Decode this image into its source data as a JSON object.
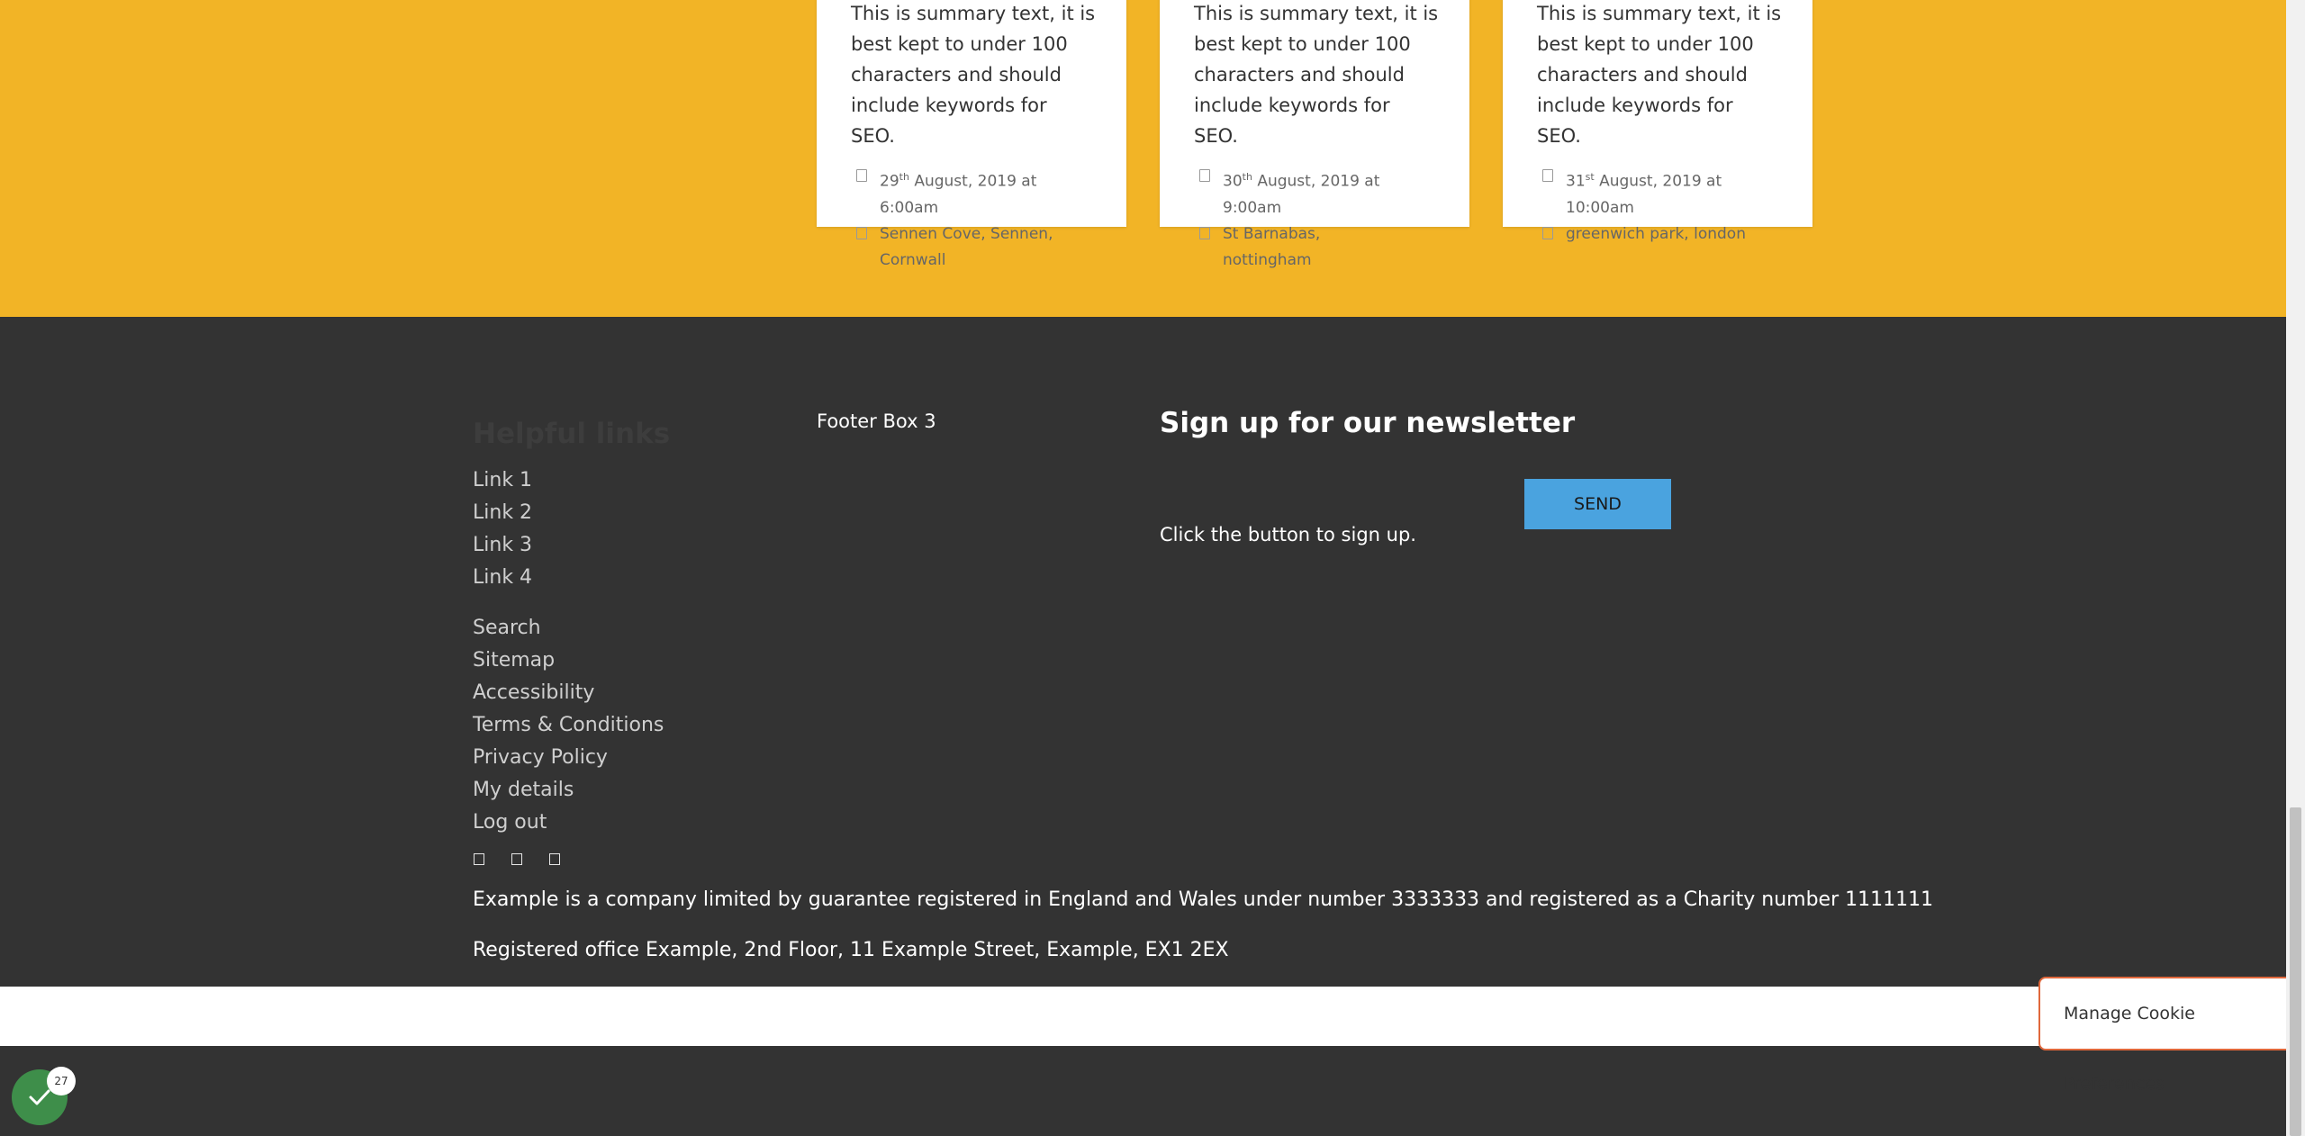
{
  "events": [
    {
      "summary": "This is summary text, it is best kept to under 100 characters and should include keywords for SEO.",
      "date_day": "29",
      "date_suffix": "th",
      "date_rest": " August, 2019 at 6:00am",
      "location": "Sennen Cove, Sennen, Cornwall"
    },
    {
      "summary": "This is summary text, it is best kept to under 100 characters and should include keywords for SEO.",
      "date_day": "30",
      "date_suffix": "th",
      "date_rest": " August, 2019 at 9:00am",
      "location": "St Barnabas, nottingham"
    },
    {
      "summary": "This is summary text, it is best kept to under 100 characters and should include keywords for SEO.",
      "date_day": "31",
      "date_suffix": "st",
      "date_rest": " August, 2019 at 10:00am",
      "location": "greenwich park, london"
    }
  ],
  "footer": {
    "helpful_heading": "Helpful links",
    "links": [
      "Link 1",
      "Link 2",
      "Link 3",
      "Link 4"
    ],
    "utility_links": [
      "Search",
      "Sitemap",
      "Accessibility",
      "Terms & Conditions",
      "Privacy Policy",
      "My details",
      "Log out"
    ],
    "social_icons": [
      "facebook-icon",
      "twitter-icon",
      "instagram-icon"
    ],
    "footer_box3": "Footer Box 3",
    "newsletter_heading": "Sign up for our newsletter",
    "send_label": "SEND",
    "newsletter_hint": "Click the button to sign up.",
    "company_text": "Example is a company limited by guarantee registered in England and Wales under number 3333333 and registered as a Charity number 1111111",
    "office_text": "Registered office Example, 2nd Floor, 11 Example Street, Example, EX1 2EX"
  },
  "cookie": {
    "label": "Manage Cookie Preferences"
  },
  "badge": {
    "count": "27"
  },
  "colors": {
    "accent_yellow": "#f2b426",
    "footer_bg": "#333333",
    "send_blue": "#4aa3df",
    "cookie_border": "#e0683c",
    "badge_green": "#3e8e4a"
  }
}
